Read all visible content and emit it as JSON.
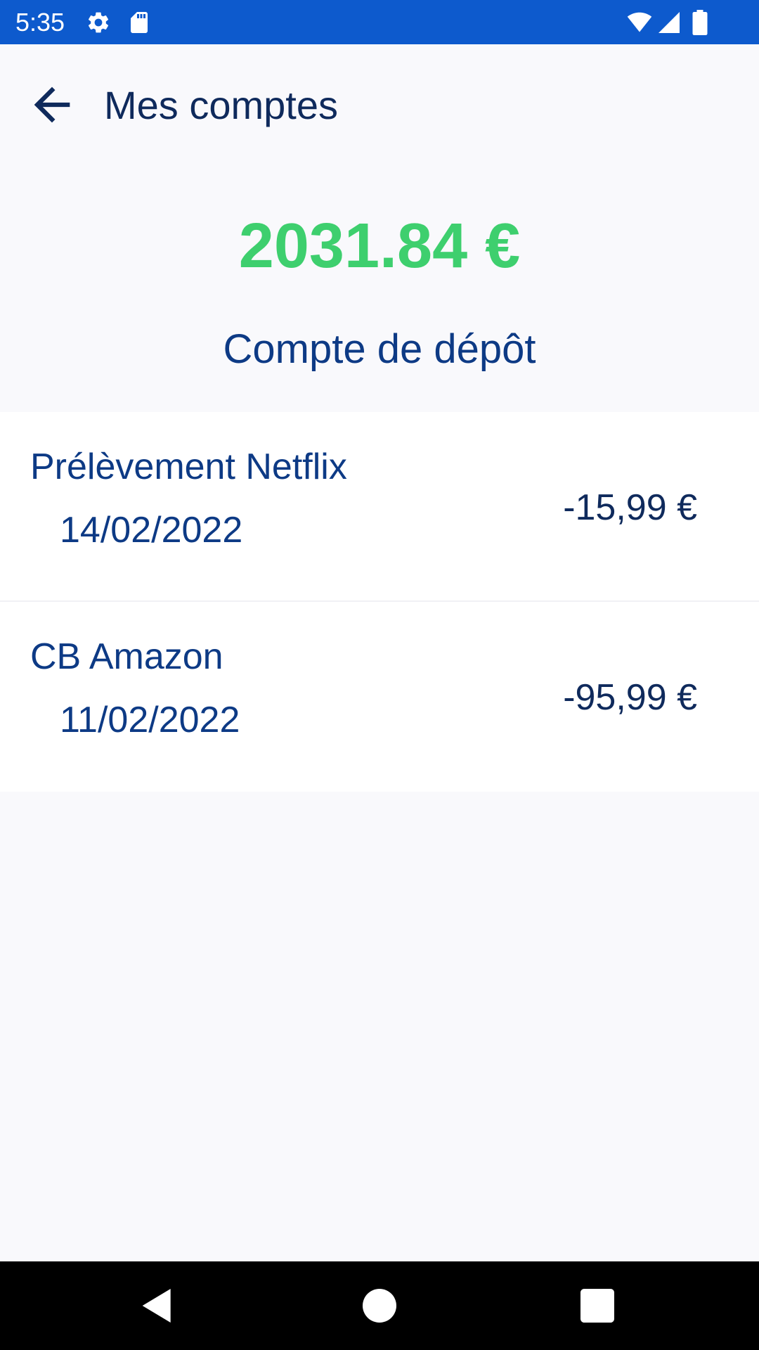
{
  "status_bar": {
    "time": "5:35",
    "icons": [
      "settings-icon",
      "sd-card-icon",
      "wifi-icon",
      "cell-signal-icon",
      "battery-icon"
    ],
    "background_color": "#0d5acd"
  },
  "app_bar": {
    "title": "Mes comptes",
    "back_icon": "arrow-back-icon"
  },
  "account": {
    "balance": "2031.84 €",
    "name": "Compte de dépôt",
    "balance_color": "#3ecf6e"
  },
  "transactions": [
    {
      "label": "Prélèvement Netflix",
      "date": "14/02/2022",
      "amount": "-15,99 €"
    },
    {
      "label": "CB Amazon",
      "date": "11/02/2022",
      "amount": "-95,99 €"
    }
  ],
  "nav_bar": {
    "buttons": [
      "back-triangle-icon",
      "home-circle-icon",
      "recents-square-icon"
    ]
  }
}
